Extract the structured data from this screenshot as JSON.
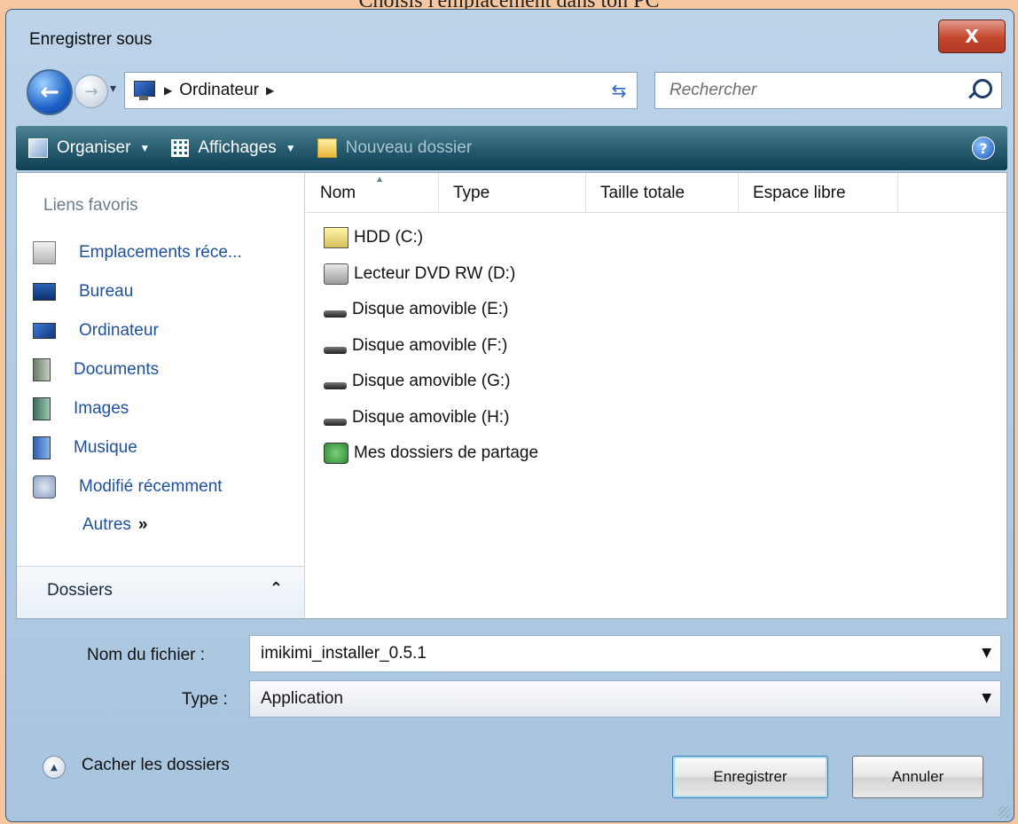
{
  "caption": "Choisis l'emplacement dans ton PC",
  "window": {
    "title": "Enregistrer sous",
    "close_label": "X"
  },
  "navigation": {
    "back_icon": "back-arrow-icon",
    "forward_icon": "forward-arrow-icon",
    "address_path": "Ordinateur",
    "search_placeholder": "Rechercher"
  },
  "toolbar": {
    "organize_label": "Organiser",
    "views_label": "Affichages",
    "new_folder_label": "Nouveau dossier"
  },
  "sidebar": {
    "title": "Liens favoris",
    "items": [
      {
        "label": "Emplacements réce...",
        "icon": "recent-places-icon"
      },
      {
        "label": "Bureau",
        "icon": "desktop-icon"
      },
      {
        "label": "Ordinateur",
        "icon": "computer-icon"
      },
      {
        "label": "Documents",
        "icon": "documents-icon"
      },
      {
        "label": "Images",
        "icon": "pictures-icon"
      },
      {
        "label": "Musique",
        "icon": "music-icon"
      },
      {
        "label": "Modifié récemment",
        "icon": "recently-changed-icon"
      }
    ],
    "more_label": "Autres",
    "more_glyph": "»",
    "folders_label": "Dossiers"
  },
  "filelist": {
    "columns": [
      "Nom",
      "Type",
      "Taille totale",
      "Espace libre"
    ],
    "items": [
      {
        "name": "HDD (C:)",
        "icon": "hard-drive-icon"
      },
      {
        "name": "Lecteur DVD RW (D:)",
        "icon": "dvd-drive-icon"
      },
      {
        "name": "Disque amovible (E:)",
        "icon": "removable-disk-icon"
      },
      {
        "name": "Disque amovible (F:)",
        "icon": "removable-disk-icon"
      },
      {
        "name": "Disque amovible (G:)",
        "icon": "removable-disk-icon"
      },
      {
        "name": "Disque amovible (H:)",
        "icon": "removable-disk-icon"
      },
      {
        "name": "Mes dossiers de partage",
        "icon": "shared-folders-icon"
      }
    ]
  },
  "form": {
    "filename_label": "Nom du fichier :",
    "filename_value": "imikimi_installer_0.5.1",
    "type_label": "Type :",
    "type_value": "Application"
  },
  "footer": {
    "hide_folders_label": "Cacher les dossiers",
    "save_label": "Enregistrer",
    "cancel_label": "Annuler"
  },
  "colors": {
    "toolbar": "#1f5468",
    "link": "#1d4f9c",
    "background": "#f5c79e"
  }
}
